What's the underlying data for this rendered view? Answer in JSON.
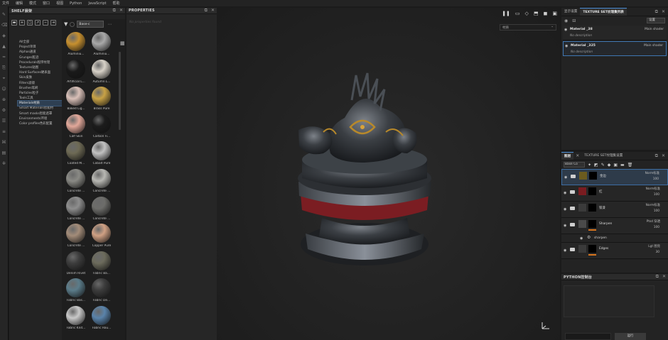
{
  "menu": [
    "文件",
    "编辑",
    "模式",
    "窗口",
    "视图",
    "Python",
    "JavaScript",
    "帮助"
  ],
  "shelf": {
    "title": "SHELF展架",
    "search_value": "Base-c",
    "categories": [
      "All全部",
      "Project项目",
      "Alphas通道",
      "Grunges脏迹",
      "Procedurals程序纹理",
      "Textures贴图",
      "Hard Surfaces硬表面",
      "Skin皮肤",
      "Filters滤镜",
      "Brushes笔刷",
      "Particles粒子",
      "Tools工具",
      "Materials材质",
      "Smart Materials智能材",
      "Smart masks智能遮罩",
      "Environments环境",
      "Color profiles色彩配置"
    ],
    "selected_category": "Materials材质",
    "materials": [
      {
        "label": "Aluminiu...",
        "color": "#c7902f"
      },
      {
        "label": "Aluminiu...",
        "color": "#a9a9a9"
      },
      {
        "label": "Artificial L...",
        "color": "#1a1a1a"
      },
      {
        "label": "Autumn L...",
        "color": "#d8d2c8"
      },
      {
        "label": "Baked Lig...",
        "color": "#d9c0b8"
      },
      {
        "label": "Brass Pure",
        "color": "#c8a246"
      },
      {
        "label": "Calf Skin",
        "color": "#e2a89a"
      },
      {
        "label": "Carbon Fi...",
        "color": "#1c1c1c"
      },
      {
        "label": "Coated M...",
        "color": "#6e6a55"
      },
      {
        "label": "Cobalt Pure",
        "color": "#c2c2c2"
      },
      {
        "label": "Concrete ...",
        "color": "#8a8a85"
      },
      {
        "label": "Concrete ...",
        "color": "#b8b8b3"
      },
      {
        "label": "Concrete ...",
        "color": "#8e8e8e"
      },
      {
        "label": "Concrete ...",
        "color": "#6d6d6a"
      },
      {
        "label": "Concrete ...",
        "color": "#a38c79"
      },
      {
        "label": "Copper Pure",
        "color": "#d0a184"
      },
      {
        "label": "Denim Rivet",
        "color": "#3d3d3d"
      },
      {
        "label": "Fabric Ba...",
        "color": "#6c6b5c"
      },
      {
        "label": "Fabric Bas...",
        "color": "#5b7c8a"
      },
      {
        "label": "Fabric De...",
        "color": "#3c3c3c"
      },
      {
        "label": "Fabric Knit...",
        "color": "#c9c9c9"
      },
      {
        "label": "Fabric Rou...",
        "color": "#5a83aa"
      }
    ]
  },
  "properties": {
    "title": "PROPERTIES",
    "empty_text": "No properties found"
  },
  "viewport": {
    "dropdown_value": "材质"
  },
  "texture_sets": {
    "tabs": [
      "显示设置",
      "TEXTURE SET纹理集列表"
    ],
    "settings_label": "设置",
    "rows": [
      {
        "name": "Material _38",
        "shader": "Main shader",
        "desc": "No description"
      },
      {
        "name": "Material _325",
        "shader": "Main shader",
        "desc": "No description"
      }
    ]
  },
  "layers": {
    "tabs": [
      "图层",
      "TEXTURE SET纹理集设置"
    ],
    "blend_mode": "Base Co",
    "items": [
      {
        "name": "金边",
        "blend": "Norm标准",
        "opacity": "100",
        "thumb": "#6b5b1f",
        "selected": true
      },
      {
        "name": "红",
        "blend": "Norm标准",
        "opacity": "100",
        "thumb": "#7a1c20"
      },
      {
        "name": "铁漆",
        "blend": "Norm标准",
        "opacity": "100",
        "thumb": "#3a3a3a"
      },
      {
        "name": "Sharpen",
        "blend": "Ptsd 穿透",
        "opacity": "100",
        "thumb": "#4a4a4a"
      },
      {
        "name": "Edges",
        "blend": "Lgt 图亮",
        "opacity": "30",
        "thumb": "#3a3a3a"
      }
    ],
    "sub_item": "sharpen"
  },
  "console": {
    "title": "PYTHON控制台",
    "run_label": "运行"
  }
}
